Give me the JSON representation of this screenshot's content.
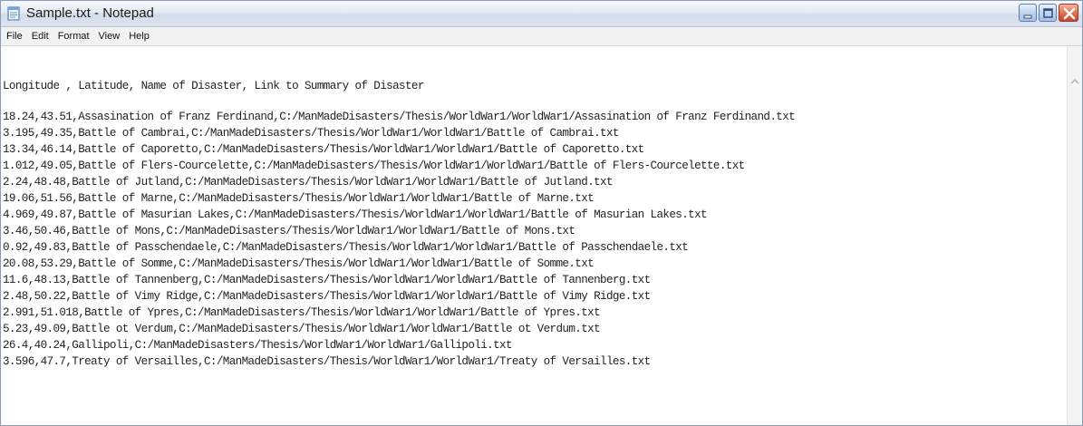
{
  "window": {
    "title": "Sample.txt - Notepad"
  },
  "menu": [
    "File",
    "Edit",
    "Format",
    "View",
    "Help"
  ],
  "editor": {
    "header_line": "Longitude , Latitude, Name of Disaster, Link to Summary of Disaster",
    "lines": [
      "18.24,43.51,Assasination of Franz Ferdinand,C:/ManMadeDisasters/Thesis/WorldWar1/WorldWar1/Assasination of Franz Ferdinand.txt",
      "3.195,49.35,Battle of Cambrai,C:/ManMadeDisasters/Thesis/WorldWar1/WorldWar1/Battle of Cambrai.txt",
      "13.34,46.14,Battle of Caporetto,C:/ManMadeDisasters/Thesis/WorldWar1/WorldWar1/Battle of Caporetto.txt",
      "1.012,49.05,Battle of Flers-Courcelette,C:/ManMadeDisasters/Thesis/WorldWar1/WorldWar1/Battle of Flers-Courcelette.txt",
      "2.24,48.48,Battle of Jutland,C:/ManMadeDisasters/Thesis/WorldWar1/WorldWar1/Battle of Jutland.txt",
      "19.06,51.56,Battle of Marne,C:/ManMadeDisasters/Thesis/WorldWar1/WorldWar1/Battle of Marne.txt",
      "4.969,49.87,Battle of Masurian Lakes,C:/ManMadeDisasters/Thesis/WorldWar1/WorldWar1/Battle of Masurian Lakes.txt",
      "3.46,50.46,Battle of Mons,C:/ManMadeDisasters/Thesis/WorldWar1/WorldWar1/Battle of Mons.txt",
      "0.92,49.83,Battle of Passchendaele,C:/ManMadeDisasters/Thesis/WorldWar1/WorldWar1/Battle of Passchendaele.txt",
      "20.08,53.29,Battle of Somme,C:/ManMadeDisasters/Thesis/WorldWar1/WorldWar1/Battle of Somme.txt",
      "11.6,48.13,Battle of Tannenberg,C:/ManMadeDisasters/Thesis/WorldWar1/WorldWar1/Battle of Tannenberg.txt",
      "2.48,50.22,Battle of Vimy Ridge,C:/ManMadeDisasters/Thesis/WorldWar1/WorldWar1/Battle of Vimy Ridge.txt",
      "2.991,51.018,Battle of Ypres,C:/ManMadeDisasters/Thesis/WorldWar1/WorldWar1/Battle of Ypres.txt",
      "5.23,49.09,Battle ot Verdum,C:/ManMadeDisasters/Thesis/WorldWar1/WorldWar1/Battle ot Verdum.txt",
      "26.4,40.24,Gallipoli,C:/ManMadeDisasters/Thesis/WorldWar1/WorldWar1/Gallipoli.txt",
      "3.596,47.7,Treaty of Versailles,C:/ManMadeDisasters/Thesis/WorldWar1/WorldWar1/Treaty of Versailles.txt"
    ]
  },
  "icons": {
    "app": "notepad-icon",
    "minimize": "minimize-icon",
    "maximize": "maximize-icon",
    "close": "close-icon",
    "scroll_up": "scroll-up-arrow-icon"
  },
  "colors": {
    "close_button": "#d9532f",
    "caption_button": "#b6c9ea",
    "text": "#222222"
  }
}
